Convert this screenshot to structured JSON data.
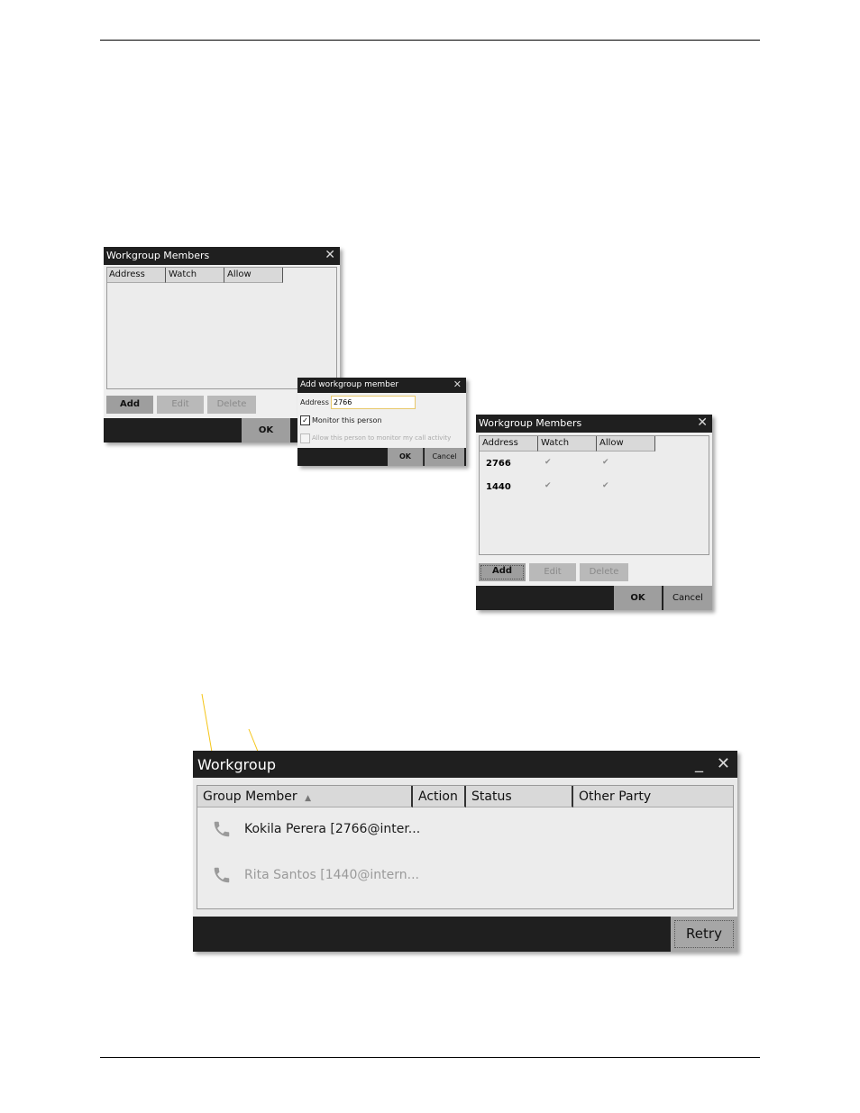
{
  "dialog_empty": {
    "title": "Workgroup Members",
    "columns": [
      "Address",
      "Watch",
      "Allow"
    ],
    "buttons": {
      "add": "Add",
      "edit": "Edit",
      "delete": "Delete",
      "ok": "OK"
    }
  },
  "dialog_add": {
    "title": "Add workgroup member",
    "address_label": "Address",
    "address_value": "2766",
    "monitor_label": "Monitor this person",
    "monitor_checked": true,
    "allow_label": "Allow this person to monitor my call activity",
    "allow_checked": false,
    "buttons": {
      "ok": "OK",
      "cancel": "Cancel"
    }
  },
  "dialog_filled": {
    "title": "Workgroup Members",
    "columns": [
      "Address",
      "Watch",
      "Allow"
    ],
    "rows": [
      {
        "address": "2766",
        "watch": "✔",
        "allow": "✔"
      },
      {
        "address": "1440",
        "watch": "✔",
        "allow": "✔"
      }
    ],
    "buttons": {
      "add": "Add",
      "edit": "Edit",
      "delete": "Delete",
      "ok": "OK",
      "cancel": "Cancel"
    }
  },
  "workgroup": {
    "title": "Workgroup",
    "columns": {
      "member": "Group Member",
      "action": "Action",
      "status": "Status",
      "other": "Other Party"
    },
    "members": [
      {
        "name": "Kokila Perera [2766@inter...",
        "color": "#1a1a1a"
      },
      {
        "name": "Rita Santos [1440@intern...",
        "color": "#9a9a9a"
      }
    ],
    "retry": "Retry",
    "callout_color": "#f5c518"
  }
}
